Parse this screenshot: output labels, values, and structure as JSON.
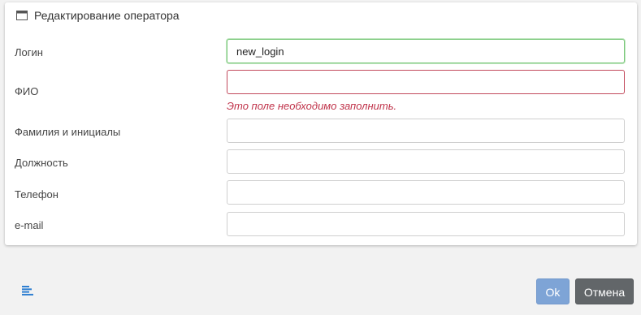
{
  "dialog": {
    "title": "Редактирование оператора",
    "icon": "window-icon"
  },
  "form": {
    "login": {
      "label": "Логин",
      "value": "new_login"
    },
    "fio": {
      "label": "ФИО",
      "value": "",
      "error": "Это поле необходимо заполнить."
    },
    "short_name": {
      "label": "Фамилия и инициалы",
      "value": ""
    },
    "position": {
      "label": "Должность",
      "value": ""
    },
    "phone": {
      "label": "Телефон",
      "value": ""
    },
    "email": {
      "label": "e-mail",
      "value": ""
    }
  },
  "footer": {
    "menu_icon": "align-left-icon",
    "ok_label": "Ok",
    "cancel_label": "Отмена"
  },
  "colors": {
    "ok_button": "#7ea4d6",
    "cancel_button": "#626669",
    "error": "#c0334a",
    "active_border": "#7ac77a"
  }
}
